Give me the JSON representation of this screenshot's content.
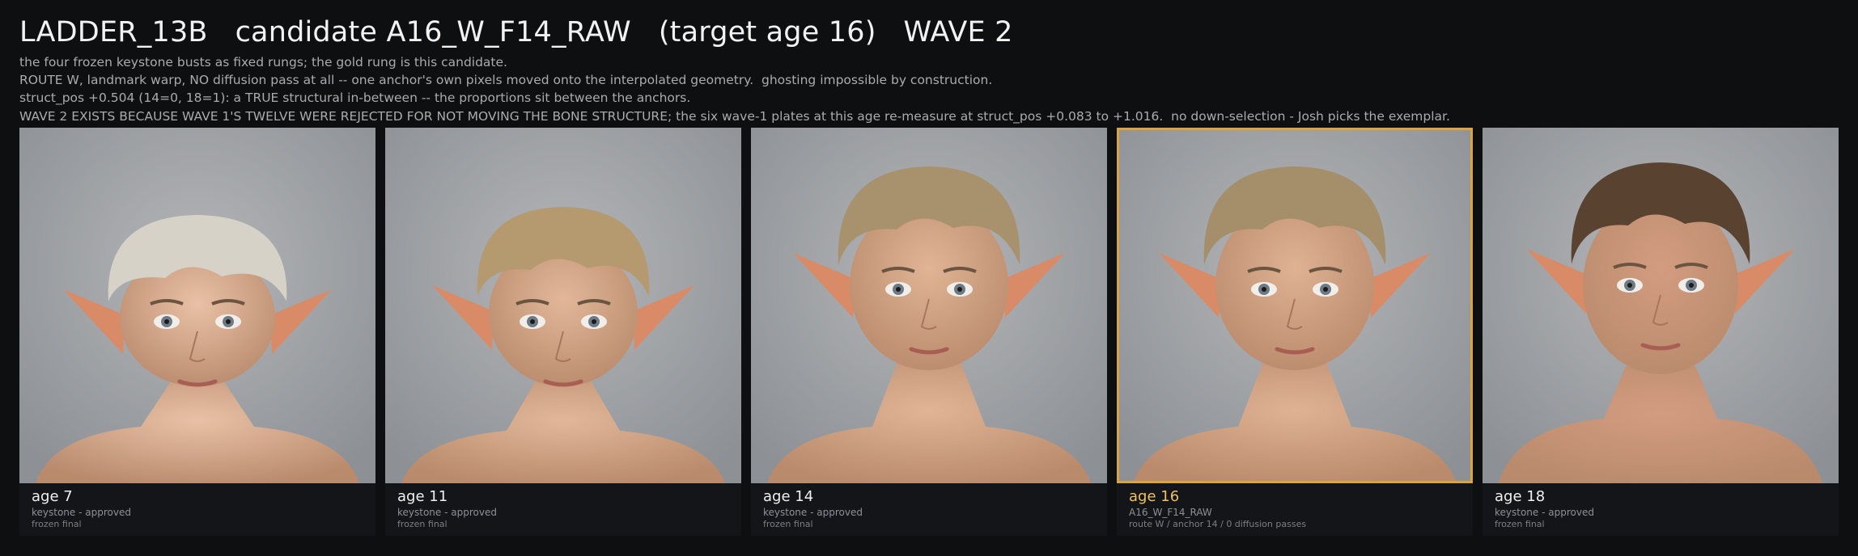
{
  "header": {
    "title": "LADDER_13B   candidate A16_W_F14_RAW   (target age 16)   WAVE 2",
    "lines": [
      "the four frozen keystone busts as fixed rungs; the gold rung is this candidate.",
      "ROUTE W, landmark warp, NO diffusion pass at all -- one anchor's own pixels moved onto the interpolated geometry.  ghosting impossible by construction.",
      "struct_pos +0.504 (14=0, 18=1): a TRUE structural in-between -- the proportions sit between the anchors.",
      "WAVE 2 EXISTS BECAUSE WAVE 1'S TWELVE WERE REJECTED FOR NOT MOVING THE BONE STRUCTURE; the six wave-1 plates at this age re-measure at struct_pos +0.083 to +1.016.  no down-selection - Josh picks the exemplar."
    ]
  },
  "accent_color": "#d9a441",
  "cards": [
    {
      "age": "age 7",
      "line1": "keystone - approved",
      "line2": "frozen final",
      "selected": false,
      "hair": "#d6d2c8",
      "skin": "#e9c1a6"
    },
    {
      "age": "age 11",
      "line1": "keystone - approved",
      "line2": "frozen final",
      "selected": false,
      "hair": "#b59a70",
      "skin": "#e2b799"
    },
    {
      "age": "age 14",
      "line1": "keystone - approved",
      "line2": "frozen final",
      "selected": false,
      "hair": "#a8926e",
      "skin": "#e0b495"
    },
    {
      "age": "age 16",
      "line1": "A16_W_F14_RAW",
      "line2": "route W / anchor 14 / 0 diffusion passes",
      "selected": true,
      "hair": "#a58e6a",
      "skin": "#dfb293"
    },
    {
      "age": "age 18",
      "line1": "keystone - approved",
      "line2": "frozen final",
      "selected": false,
      "hair": "#5a4230",
      "skin": "#d39c80"
    }
  ]
}
